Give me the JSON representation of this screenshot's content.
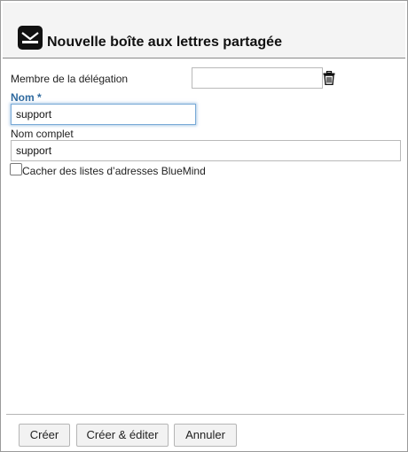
{
  "dialog": {
    "title": "Nouvelle boîte aux lettres partagée",
    "icon": "mail-icon"
  },
  "form": {
    "delegation": {
      "label": "Membre de la délégation",
      "value": "",
      "delete_icon": "trash-icon"
    },
    "name": {
      "label": "Nom *",
      "value": "support"
    },
    "full_name": {
      "label": "Nom complet",
      "value": "support"
    },
    "hide_from_lists": {
      "label": "Cacher des listes d’adresses BlueMind",
      "checked": false
    }
  },
  "footer": {
    "create_label": "Créer",
    "create_edit_label": "Créer & éditer",
    "cancel_label": "Annuler"
  },
  "colors": {
    "required_label": "#2f6a9f",
    "focus_border": "#78a9d6"
  }
}
